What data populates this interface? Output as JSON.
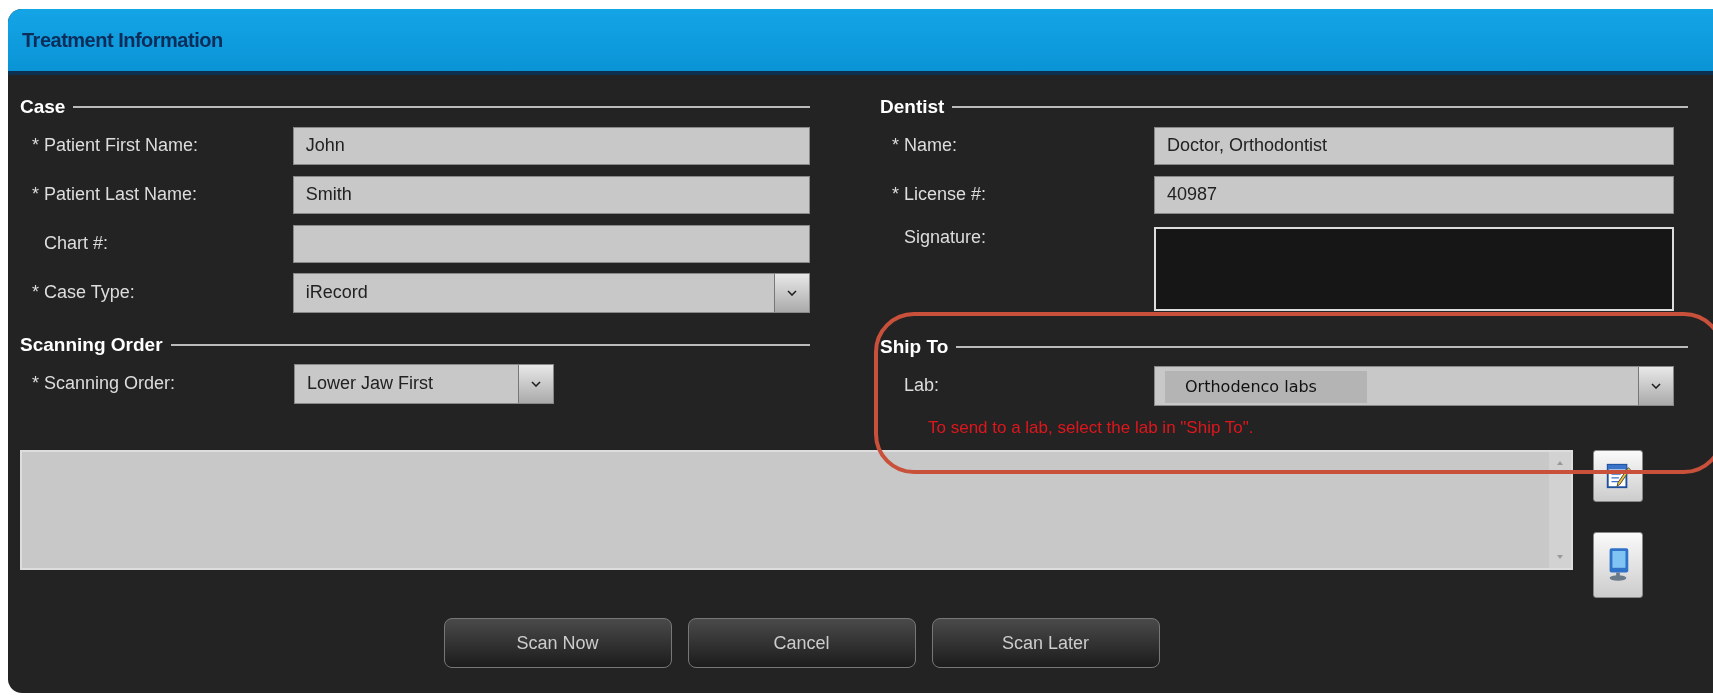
{
  "window": {
    "title": "Treatment Information"
  },
  "case": {
    "heading": "Case",
    "fields": [
      {
        "kind": "text",
        "marker": "*",
        "label": "Patient First Name:",
        "value": "John"
      },
      {
        "kind": "text",
        "marker": "*",
        "label": "Patient Last Name:",
        "value": "Smith"
      },
      {
        "kind": "text",
        "label": "Chart #:"
      },
      {
        "kind": "select",
        "marker": "*",
        "label": "Case Type:",
        "value": "iRecord"
      }
    ]
  },
  "scanning_order": {
    "heading": "Scanning Order",
    "fields": [
      {
        "kind": "select",
        "marker": "*",
        "label": "Scanning Order:",
        "value": "Lower Jaw First"
      }
    ]
  },
  "dentist": {
    "heading": "Dentist",
    "fields": [
      {
        "kind": "text",
        "marker": "*",
        "label": "Name:",
        "value": "Doctor, Orthodontist"
      },
      {
        "kind": "text",
        "marker": "*",
        "label": "License #:",
        "value": "40987"
      },
      {
        "kind": "signature",
        "label": "Signature:"
      }
    ]
  },
  "ship_to": {
    "heading": "Ship To",
    "fields": [
      {
        "kind": "select",
        "label": "Lab:",
        "value": "Orthodenco labs"
      }
    ],
    "hint": "To send to a lab, select the lab in \"Ship To\"."
  },
  "buttons": [
    "Scan Now",
    "Cancel",
    "Scan Later"
  ]
}
